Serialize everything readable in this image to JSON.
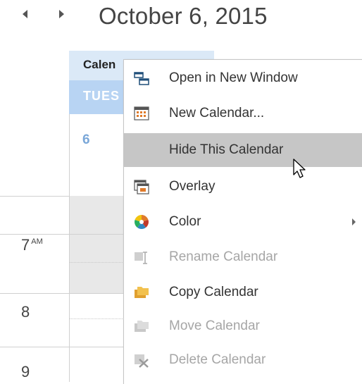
{
  "header": {
    "date_title": "October 6, 2015",
    "prev_icon": "chevron-left-icon",
    "next_icon": "chevron-right-icon"
  },
  "calendar": {
    "tab_label": "Calen",
    "day_header": "TUES",
    "day_number": "6",
    "hours": [
      {
        "label": "7",
        "suffix": "AM"
      },
      {
        "label": "8",
        "suffix": ""
      },
      {
        "label": "9",
        "suffix": ""
      }
    ]
  },
  "context_menu": {
    "items": [
      {
        "label": "Open in New Window",
        "icon": "open-window-icon",
        "enabled": true
      },
      {
        "label": "New Calendar...",
        "icon": "new-calendar-icon",
        "enabled": true
      },
      {
        "label": "Hide This Calendar",
        "icon": "",
        "enabled": true,
        "hovered": true
      },
      {
        "label": "Overlay",
        "icon": "overlay-icon",
        "enabled": true
      },
      {
        "label": "Color",
        "icon": "color-wheel-icon",
        "enabled": true,
        "submenu": true
      },
      {
        "label": "Rename Calendar",
        "icon": "rename-icon",
        "enabled": false
      },
      {
        "label": "Copy Calendar",
        "icon": "copy-folder-icon",
        "enabled": true
      },
      {
        "label": "Move Calendar",
        "icon": "move-folder-icon",
        "enabled": false
      },
      {
        "label": "Delete Calendar",
        "icon": "delete-icon",
        "enabled": false
      }
    ]
  },
  "colors": {
    "accent": "#b8d4f3",
    "hover": "#c6c6c6",
    "disabled_text": "#a6a6a6"
  }
}
